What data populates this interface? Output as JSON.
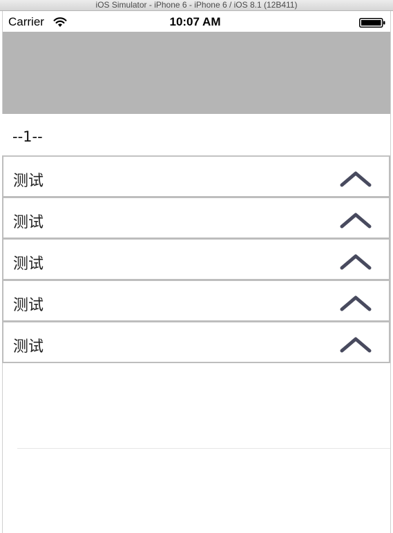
{
  "simulator": {
    "title": "iOS Simulator - iPhone 6 - iPhone 6 / iOS 8.1 (12B411)"
  },
  "status_bar": {
    "carrier": "Carrier",
    "time": "10:07 AM",
    "wifi_icon": "wifi-icon",
    "battery_icon": "battery-full-icon"
  },
  "section": {
    "title": "--1--"
  },
  "list": {
    "items": [
      {
        "label": "测试",
        "icon": "chevron-up-icon"
      },
      {
        "label": "测试",
        "icon": "chevron-up-icon"
      },
      {
        "label": "测试",
        "icon": "chevron-up-icon"
      },
      {
        "label": "测试",
        "icon": "chevron-up-icon"
      },
      {
        "label": "测试",
        "icon": "chevron-up-icon"
      }
    ]
  },
  "colors": {
    "header_gray": "#b5b5b5",
    "chevron": "#484a5e",
    "border": "#bdbdbd"
  }
}
